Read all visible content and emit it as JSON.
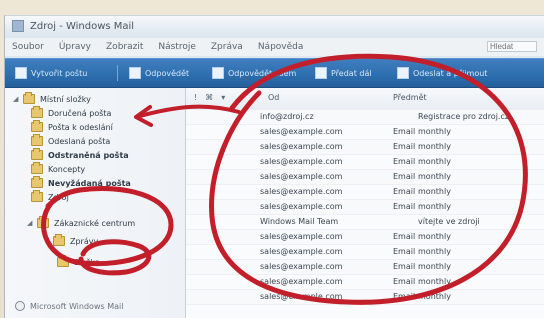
{
  "window": {
    "title": "Zdroj - Windows Mail"
  },
  "menu": [
    "Soubor",
    "Úpravy",
    "Zobrazit",
    "Nástroje",
    "Zpráva",
    "Nápověda"
  ],
  "search": {
    "placeholder": "Hledat"
  },
  "toolbar": [
    "Vytvořit poštu",
    "Odpovědět",
    "Odpovědět všem",
    "Předat dál",
    "Odeslat a přijmout"
  ],
  "sidebar": {
    "items": [
      {
        "label": "Místní složky",
        "indent": 0,
        "bold": false
      },
      {
        "label": "Doručená pošta",
        "indent": 1,
        "bold": false
      },
      {
        "label": "Pošta k odeslání",
        "indent": 1,
        "bold": false
      },
      {
        "label": "Odeslaná pošta",
        "indent": 1,
        "bold": false
      },
      {
        "label": "Odstraněná pošta",
        "indent": 1,
        "bold": true
      },
      {
        "label": "Koncepty",
        "indent": 1,
        "bold": false
      },
      {
        "label": "Nevyžádaná pošta",
        "indent": 1,
        "bold": true
      },
      {
        "label": "Zdroj",
        "indent": 1,
        "bold": false
      },
      {
        "label": "Zákaznické centrum",
        "indent": 1,
        "bold": false
      },
      {
        "label": "Zprávy",
        "indent": 2,
        "bold": false
      },
      {
        "label": "Složka",
        "indent": 2,
        "bold": false
      }
    ],
    "footer": "Microsoft Windows Mail"
  },
  "list": {
    "columns": [
      "Od",
      "Předmět"
    ],
    "rows": [
      {
        "from": "info@zdroj.cz",
        "tag": "",
        "subject": "Registrace pro zdroj.cz"
      },
      {
        "from": "sales@example.com",
        "tag": "Email",
        "subject": "monthly"
      },
      {
        "from": "sales@example.com",
        "tag": "Email",
        "subject": "monthly"
      },
      {
        "from": "sales@example.com",
        "tag": "Email",
        "subject": "monthly"
      },
      {
        "from": "sales@example.com",
        "tag": "Email",
        "subject": "monthly"
      },
      {
        "from": "sales@example.com",
        "tag": "Email",
        "subject": "monthly"
      },
      {
        "from": "sales@example.com",
        "tag": "Email",
        "subject": "monthly"
      },
      {
        "from": "Windows Mail Team",
        "tag": "",
        "subject": "vítejte ve zdroji"
      },
      {
        "from": "sales@example.com",
        "tag": "Email",
        "subject": "monthly"
      },
      {
        "from": "sales@example.com",
        "tag": "Email",
        "subject": "monthly"
      },
      {
        "from": "sales@example.com",
        "tag": "Email",
        "subject": "monthly"
      },
      {
        "from": "sales@example.com",
        "tag": "Email",
        "subject": "monthly"
      },
      {
        "from": "sales@example.com",
        "tag": "Email",
        "subject": "monthly"
      }
    ]
  },
  "annotations": {
    "color": "#c21f2a"
  }
}
